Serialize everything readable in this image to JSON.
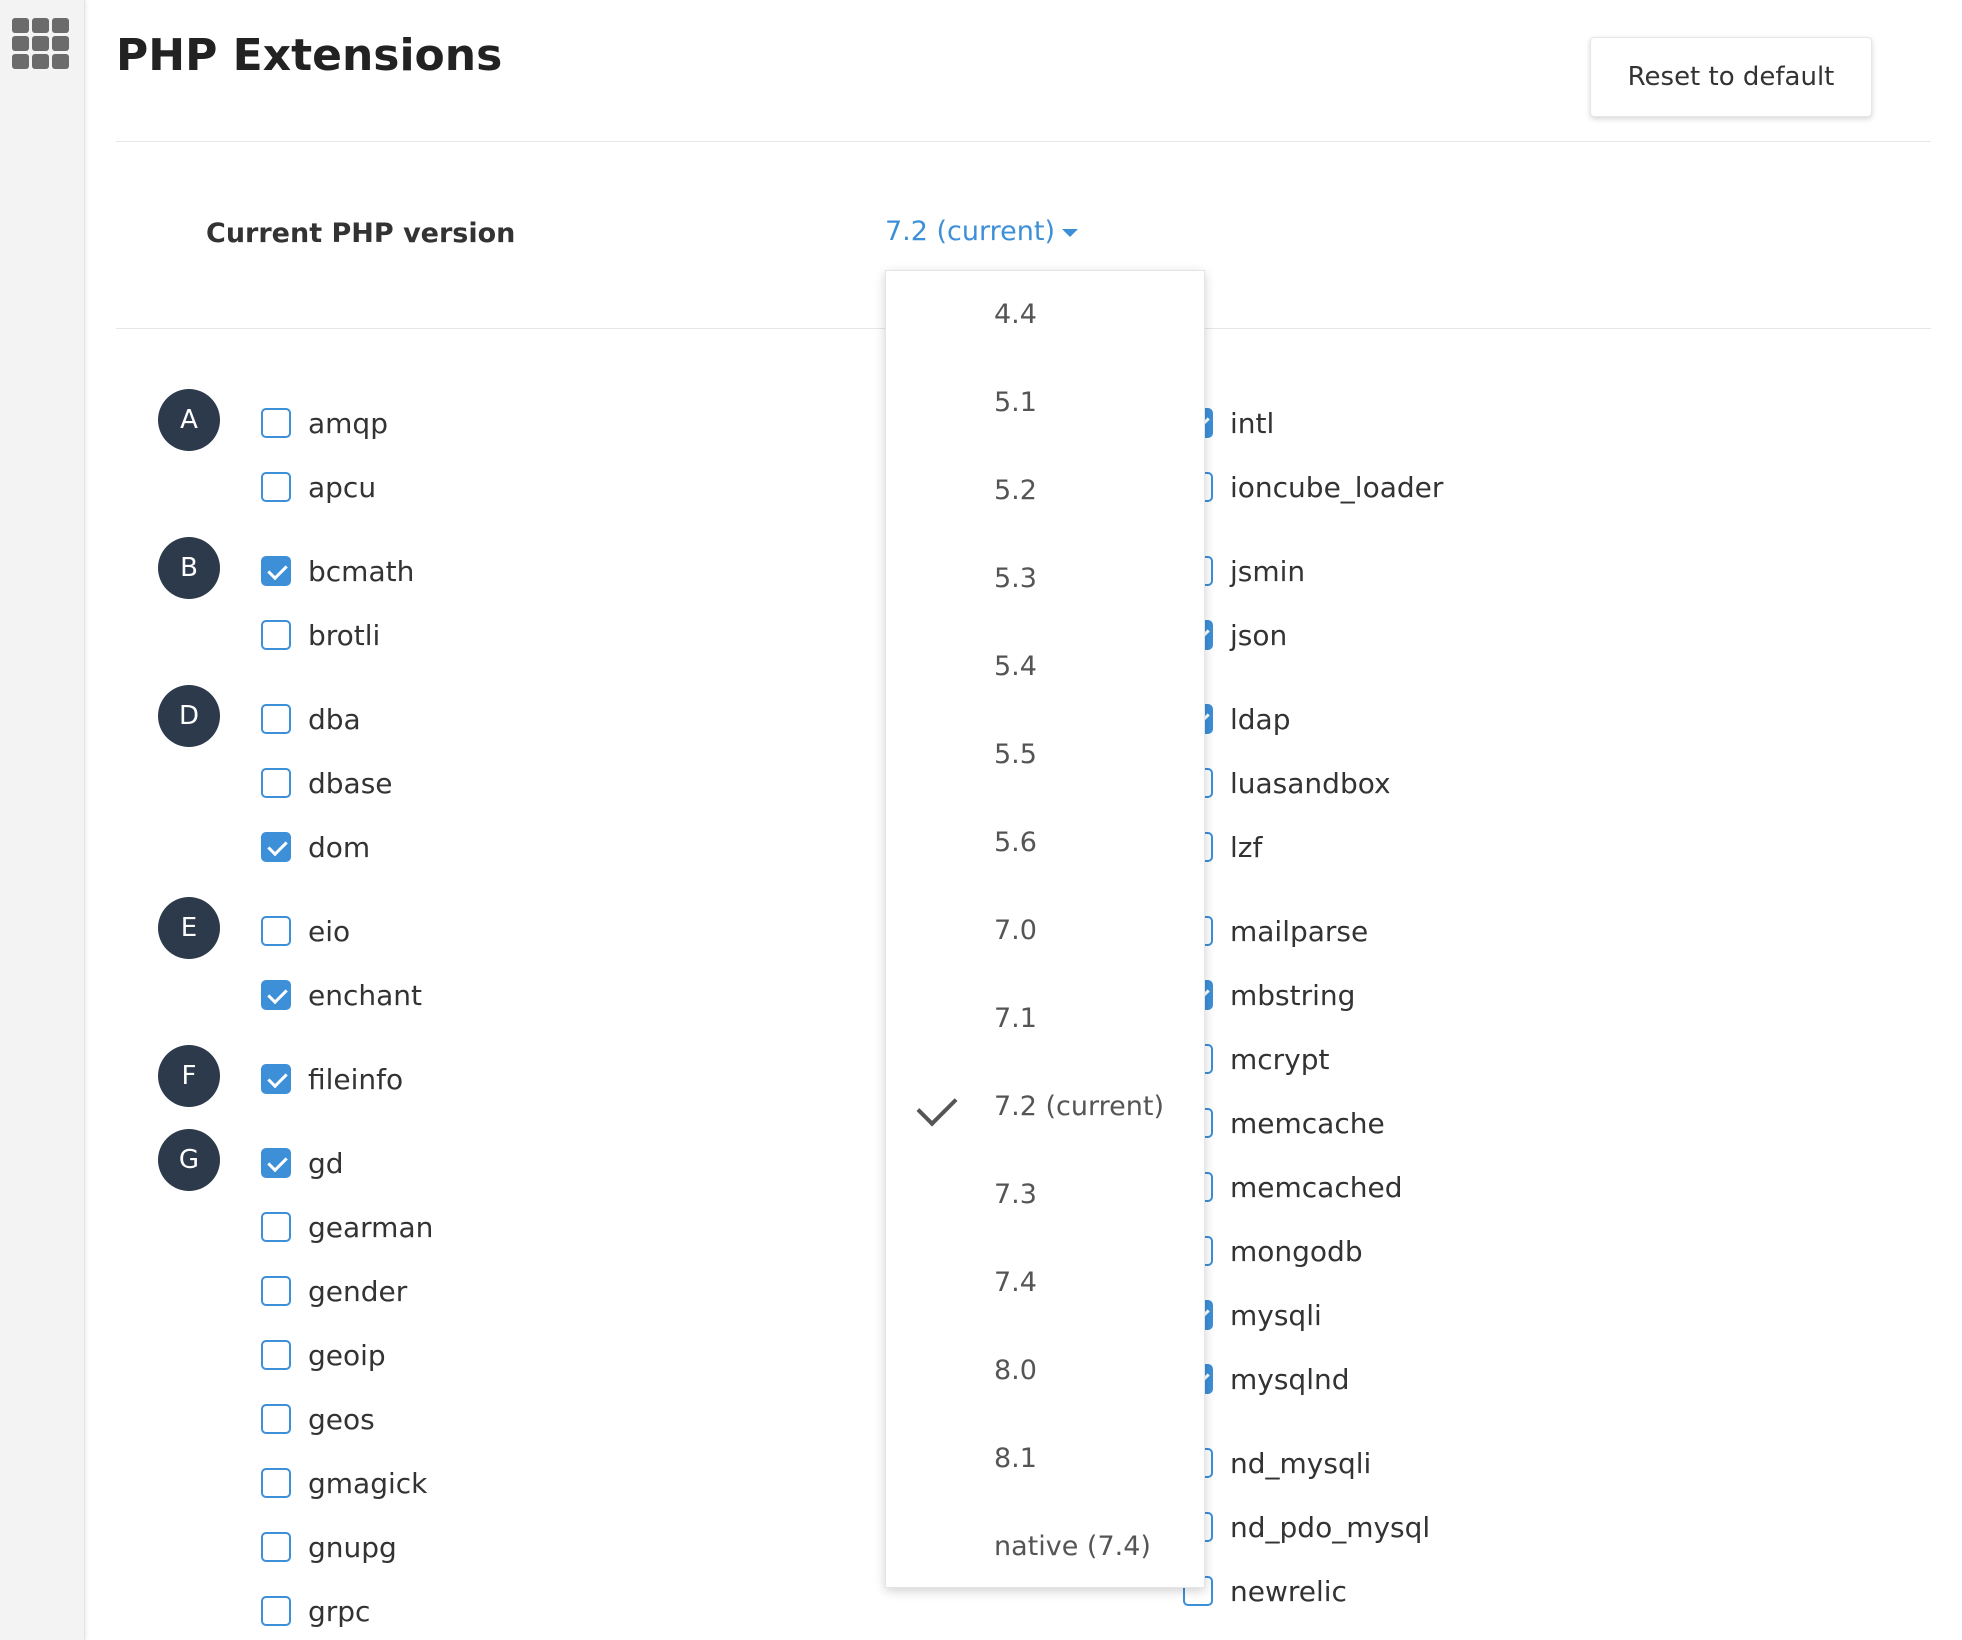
{
  "header": {
    "title": "PHP Extensions",
    "reset_label": "Reset to default"
  },
  "version": {
    "label": "Current PHP version",
    "selected": "7.2 (current)"
  },
  "dropdown": {
    "options": [
      {
        "label": "4.4",
        "selected": false
      },
      {
        "label": "5.1",
        "selected": false
      },
      {
        "label": "5.2",
        "selected": false
      },
      {
        "label": "5.3",
        "selected": false
      },
      {
        "label": "5.4",
        "selected": false
      },
      {
        "label": "5.5",
        "selected": false
      },
      {
        "label": "5.6",
        "selected": false
      },
      {
        "label": "7.0",
        "selected": false
      },
      {
        "label": "7.1",
        "selected": false
      },
      {
        "label": "7.2 (current)",
        "selected": true
      },
      {
        "label": "7.3",
        "selected": false
      },
      {
        "label": "7.4",
        "selected": false
      },
      {
        "label": "8.0",
        "selected": false
      },
      {
        "label": "8.1",
        "selected": false
      },
      {
        "label": "native (7.4)",
        "selected": false
      }
    ]
  },
  "letters": [
    "A",
    "B",
    "D",
    "E",
    "F",
    "G"
  ],
  "left_extensions": [
    {
      "name": "amqp",
      "checked": false
    },
    {
      "name": "apcu",
      "checked": false
    },
    {
      "name": "bcmath",
      "checked": true
    },
    {
      "name": "brotli",
      "checked": false
    },
    {
      "name": "dba",
      "checked": false
    },
    {
      "name": "dbase",
      "checked": false
    },
    {
      "name": "dom",
      "checked": true
    },
    {
      "name": "eio",
      "checked": false
    },
    {
      "name": "enchant",
      "checked": true
    },
    {
      "name": "fileinfo",
      "checked": true
    },
    {
      "name": "gd",
      "checked": true
    },
    {
      "name": "gearman",
      "checked": false
    },
    {
      "name": "gender",
      "checked": false
    },
    {
      "name": "geoip",
      "checked": false
    },
    {
      "name": "geos",
      "checked": false
    },
    {
      "name": "gmagick",
      "checked": false
    },
    {
      "name": "gnupg",
      "checked": false
    },
    {
      "name": "grpc",
      "checked": false
    }
  ],
  "right_extensions": [
    {
      "name": "intl",
      "checked": true
    },
    {
      "name": "ioncube_loader",
      "checked": false
    },
    {
      "name": "jsmin",
      "checked": false
    },
    {
      "name": "json",
      "checked": true
    },
    {
      "name": "ldap",
      "checked": true
    },
    {
      "name": "luasandbox",
      "checked": false
    },
    {
      "name": "lzf",
      "checked": false
    },
    {
      "name": "mailparse",
      "checked": false
    },
    {
      "name": "mbstring",
      "checked": true
    },
    {
      "name": "mcrypt",
      "checked": false
    },
    {
      "name": "memcache",
      "checked": false
    },
    {
      "name": "memcached",
      "checked": false
    },
    {
      "name": "mongodb",
      "checked": false
    },
    {
      "name": "mysqli",
      "checked": true
    },
    {
      "name": "mysqlnd",
      "checked": true
    },
    {
      "name": "nd_mysqli",
      "checked": false
    },
    {
      "name": "nd_pdo_mysql",
      "checked": false
    },
    {
      "name": "newrelic",
      "checked": false
    }
  ],
  "colors": {
    "accent": "#3d8fd8",
    "letter_badge": "#2d3a4b"
  },
  "icons": {
    "apps": "apps-grid-icon",
    "caret": "caret-down-icon",
    "selected": "checkmark-icon"
  }
}
